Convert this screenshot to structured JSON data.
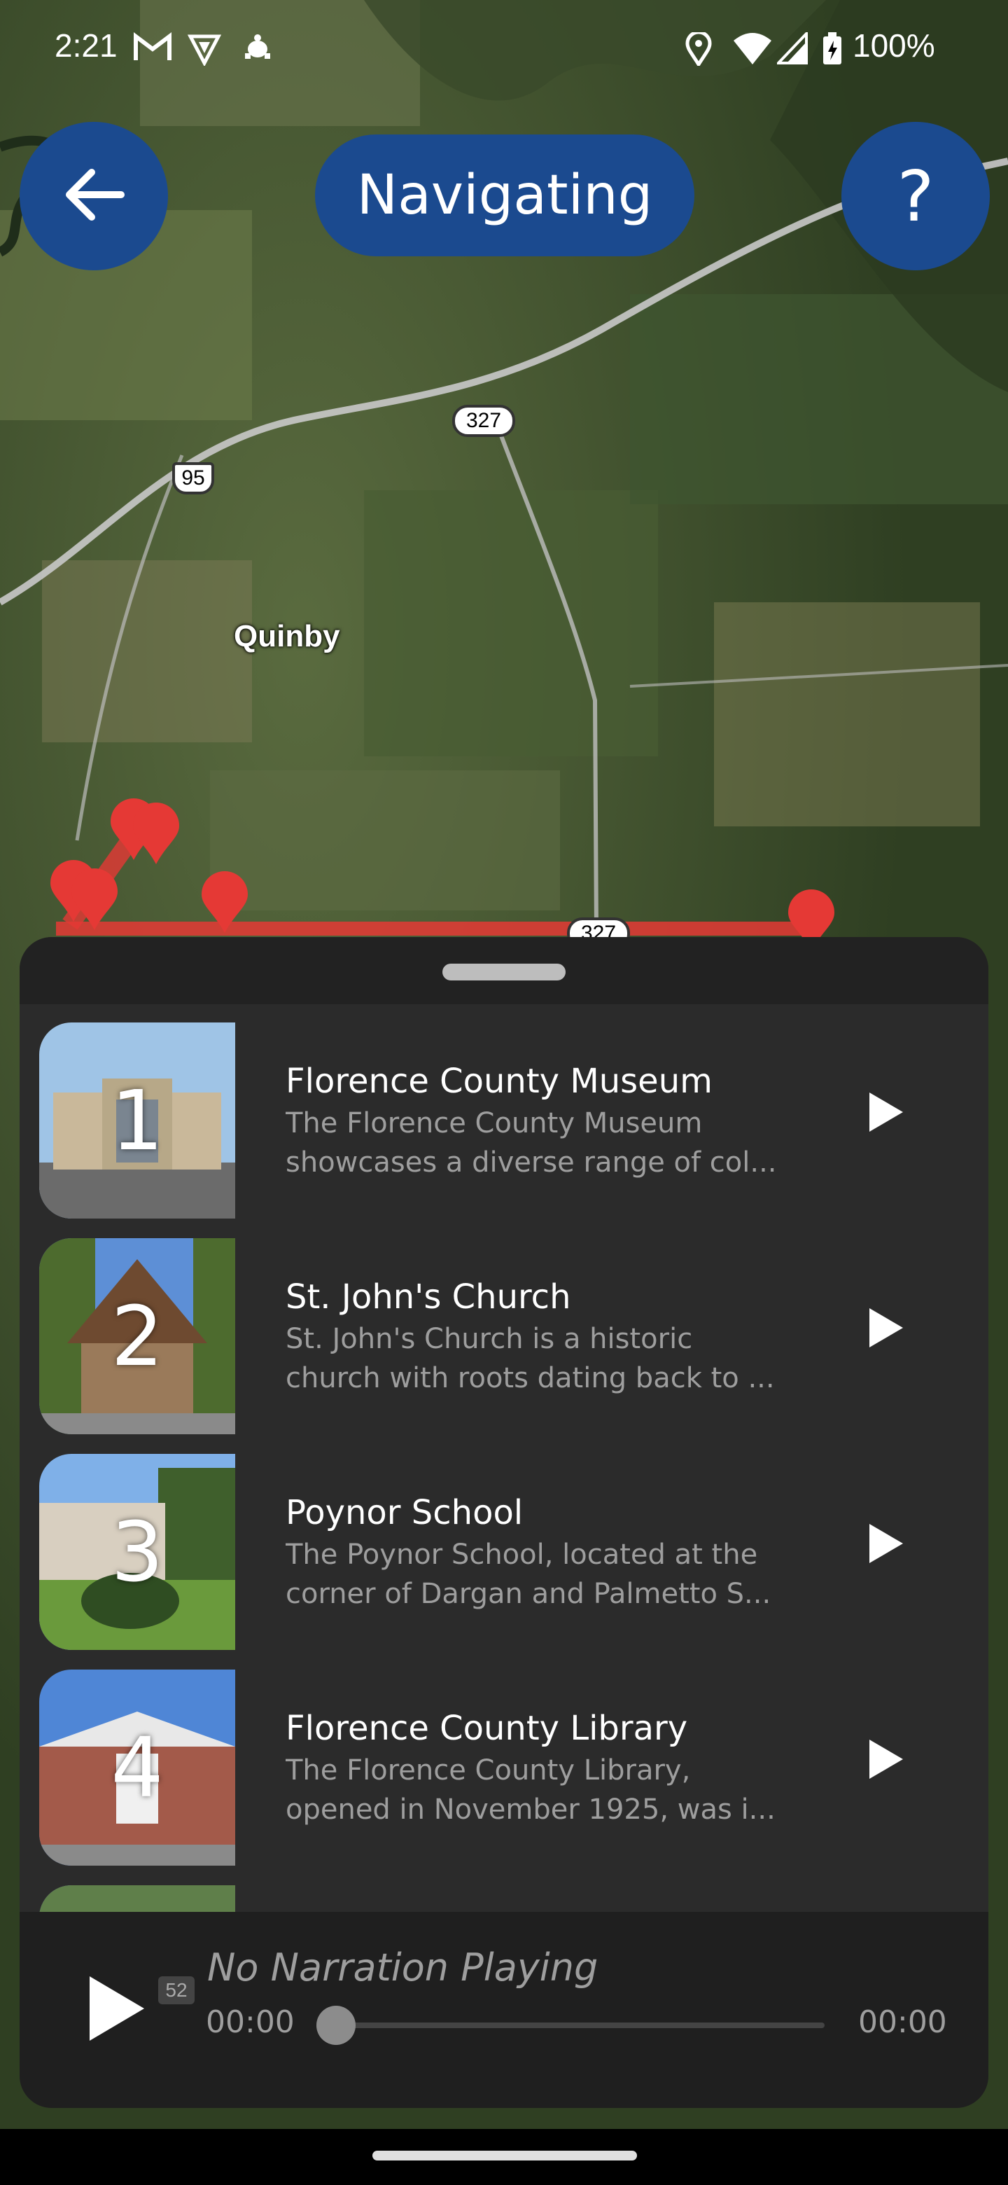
{
  "status_bar": {
    "time": "2:21",
    "battery": "100%",
    "icons": [
      "gmail-icon",
      "vpn-shield-icon",
      "turtle-icon",
      "location-icon",
      "wifi-icon",
      "signal-icon",
      "battery-charging-icon"
    ]
  },
  "header": {
    "back_icon": "arrow-left-icon",
    "title": "Navigating",
    "help_label": "?"
  },
  "map": {
    "place_label": "Quinby",
    "road_shields": [
      "327",
      "95",
      "327"
    ],
    "pin_color": "#e53935"
  },
  "sites": [
    {
      "number": "1",
      "title": "Florence County Museum",
      "desc_line1": "The Florence County Museum",
      "desc_line2": "showcases a diverse range of col..."
    },
    {
      "number": "2",
      "title": "St. John's Church",
      "desc_line1": "St. John's Church is a historic",
      "desc_line2": "church with roots dating back to ..."
    },
    {
      "number": "3",
      "title": "Poynor School",
      "desc_line1": "The Poynor School, located at the",
      "desc_line2": "corner of Dargan and Palmetto S..."
    },
    {
      "number": "4",
      "title": "Florence County Library",
      "desc_line1": "The Florence County Library,",
      "desc_line2": "opened in November 1925, was i..."
    }
  ],
  "player": {
    "now_playing": "No Narration Playing",
    "elapsed": "00:00",
    "duration": "00:00",
    "progress": 0,
    "badge": "52"
  },
  "colors": {
    "primary": "#1b4a8f",
    "sheet": "#2b2b2b",
    "route": "#e53935"
  }
}
